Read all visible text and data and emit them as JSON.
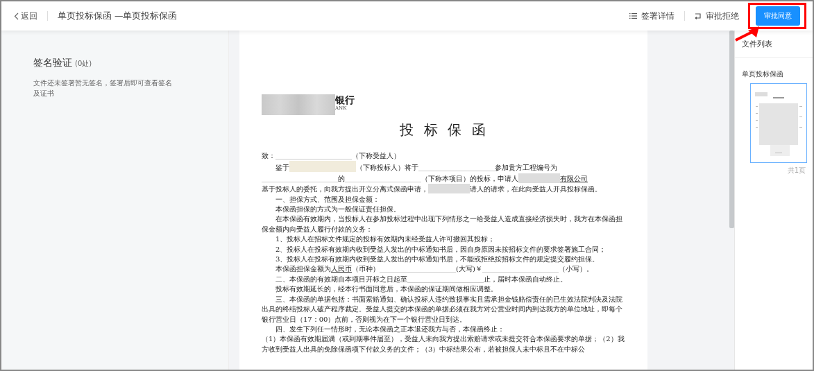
{
  "topbar": {
    "back": "返回",
    "title": "单页投标保函 —单页投标保函",
    "actions": [
      {
        "kind": "details",
        "label": "签署详情"
      },
      {
        "kind": "reject",
        "label": "审批拒绝"
      }
    ],
    "primary_button": "审批同意"
  },
  "sidebar": {
    "heading": "签名验证",
    "count": "(0处)",
    "description": "文件还未签署暂无签名，签署后即可查看签名及证书"
  },
  "document": {
    "logo": {
      "text": "银行",
      "subtext": "ANK"
    },
    "title": "投 标 保 函",
    "paragraphs": [
      {
        "indent": false,
        "segments": [
          {
            "kind": "text",
            "text": "致："
          },
          {
            "kind": "blank"
          },
          {
            "kind": "text",
            "text": "（下称受益人）"
          }
        ]
      },
      {
        "indent": true,
        "segments": [
          {
            "kind": "text",
            "text": "鉴于"
          },
          {
            "kind": "filled-blank"
          },
          {
            "kind": "text",
            "text": "（下称投标人）将于"
          },
          {
            "kind": "blank"
          },
          {
            "kind": "text",
            "text": "参加贵方工程编号为"
          }
        ]
      },
      {
        "indent": false,
        "segments": [
          {
            "kind": "blank"
          },
          {
            "kind": "text",
            "text": "的"
          },
          {
            "kind": "blank"
          },
          {
            "kind": "text",
            "text": "（下称本项目）的投标，申请人"
          },
          {
            "kind": "redacted"
          },
          {
            "kind": "underlined",
            "text": "有限公司"
          }
        ]
      },
      {
        "indent": false,
        "segments": [
          {
            "kind": "text",
            "text": "基于投标人的委托，向我方提出开立分离式保函申请，"
          },
          {
            "kind": "redacted"
          },
          {
            "kind": "text",
            "text": "请人的请求，在此向受益人开具投标保函。"
          }
        ]
      },
      {
        "indent": true,
        "segments": [
          {
            "kind": "text",
            "text": "一、担保方式、范围及担保金额："
          }
        ]
      },
      {
        "indent": true,
        "segments": [
          {
            "kind": "text",
            "text": "本保函担保的方式为一般保证责任担保。"
          }
        ]
      },
      {
        "indent": true,
        "segments": [
          {
            "kind": "text",
            "text": "在本保函有效期内，当投标人在参加投标过程中出现下列情形之一给受益人造成直接经济损失时，我方在本保函担保金额内向受益人履行付款的义务："
          }
        ]
      },
      {
        "indent": true,
        "segments": [
          {
            "kind": "text",
            "text": "1、投标人在招标文件规定的投标有效期内未经受益人许可撤回其投标；"
          }
        ]
      },
      {
        "indent": true,
        "segments": [
          {
            "kind": "text",
            "text": "2、投标人在投标有效期内收到受益人发出的中标通知书后，因自身原因未按招标文件的要求签署施工合同；"
          }
        ]
      },
      {
        "indent": true,
        "segments": [
          {
            "kind": "text",
            "text": "3、投标人在投标有效期内收到受益人发出的中标通知书后，不能或拒绝按招标文件的规定提交履约担保。"
          }
        ]
      },
      {
        "indent": true,
        "segments": [
          {
            "kind": "text",
            "text": "本保函担保金额为"
          },
          {
            "kind": "underlined",
            "text": "人民币"
          },
          {
            "kind": "text",
            "text": "（币种）"
          },
          {
            "kind": "blank"
          },
          {
            "kind": "text",
            "text": "(大写)￥"
          },
          {
            "kind": "blank"
          },
          {
            "kind": "text",
            "text": "（小写）。"
          }
        ]
      },
      {
        "indent": true,
        "segments": [
          {
            "kind": "text",
            "text": "二、本保函的有效期自本项目开标之日起至"
          },
          {
            "kind": "blank"
          },
          {
            "kind": "text",
            "text": "止，届时本保函自动终止。"
          }
        ]
      },
      {
        "indent": true,
        "segments": [
          {
            "kind": "text",
            "text": "投标有效期延长的，经本行书面同意后，本保函的保证期间做相应调整。"
          }
        ]
      },
      {
        "indent": true,
        "segments": [
          {
            "kind": "text",
            "text": "三、本保函的单据包括：书面索赔通知、确认投标人违约致损事实且需承担金钱赔偿责任的已生效法院判决及法院出具的终结投标人破产程序裁定。受益人提交的本保函的单据必须在我方对公营业时间内到达我方的单位地址，即每个银行营业日（17：00）点前，否则视为在下一个银行营业日到达。"
          }
        ]
      },
      {
        "indent": true,
        "segments": [
          {
            "kind": "text",
            "text": "四、发生下列任一情形时，无论本保函之正本退还我方与否，本保函终止："
          }
        ]
      },
      {
        "indent": false,
        "segments": [
          {
            "kind": "text",
            "text": "（1）本保函有效期届满（或到期事件届至），受益人未向我方提出索赔请求或未提交符合本保函要求的单据；（2）我方收到受益人出具的免除保函项下付款义务的文件；（3）中标结果公布，若被担保人未中标且不在中标公"
          }
        ]
      }
    ]
  },
  "file_list": {
    "title": "文件列表",
    "files": [
      {
        "name": "单页投标保函",
        "selected": true,
        "pages": "共1页"
      }
    ]
  }
}
